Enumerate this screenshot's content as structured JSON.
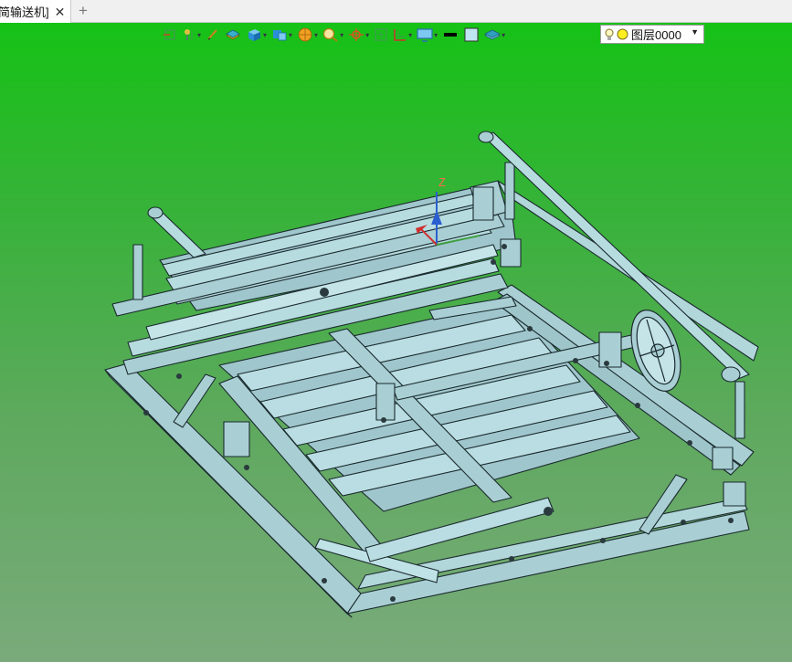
{
  "tab": {
    "title": "简输送机]",
    "close": "✕",
    "add": "+"
  },
  "toolbar": {
    "tools": [
      {
        "name": "move-tool-icon",
        "color": "#3aa04a"
      },
      {
        "name": "pin-tool-icon",
        "color": "#8aa"
      },
      {
        "name": "pen-tool-icon",
        "color": "#d08020"
      },
      {
        "name": "layer-tool-icon",
        "color": "#e0b020"
      },
      {
        "name": "box-tool-icon",
        "color": "#2b8fd8"
      },
      {
        "name": "view-tool-icon",
        "color": "#2b8fd8"
      },
      {
        "name": "render-tool-icon",
        "color": "#f0a020"
      },
      {
        "name": "zoom-tool-icon",
        "color": "#e0b020"
      },
      {
        "name": "axis-tool-icon",
        "color": "#e05020"
      },
      {
        "name": "fit-tool-icon",
        "color": "#3aa04a"
      },
      {
        "name": "section-tool-icon",
        "color": "#d03030"
      },
      {
        "name": "display-tool-icon",
        "color": "#2b6fb0"
      },
      {
        "name": "line-style-icon",
        "color": "#000000"
      },
      {
        "name": "color-swatch-icon",
        "color": "#bfe6f2"
      },
      {
        "name": "stack-tool-icon",
        "color": "#2fa0c0"
      }
    ],
    "layer": {
      "name": "图层0000",
      "dropdown": "▼"
    }
  },
  "triad": {
    "z_label": "Z"
  },
  "colors": {
    "background_top": "#16c216",
    "background_bottom": "#7aaa7b",
    "model_fill": "#a9cfd4",
    "model_edge": "#1a2a2e"
  }
}
